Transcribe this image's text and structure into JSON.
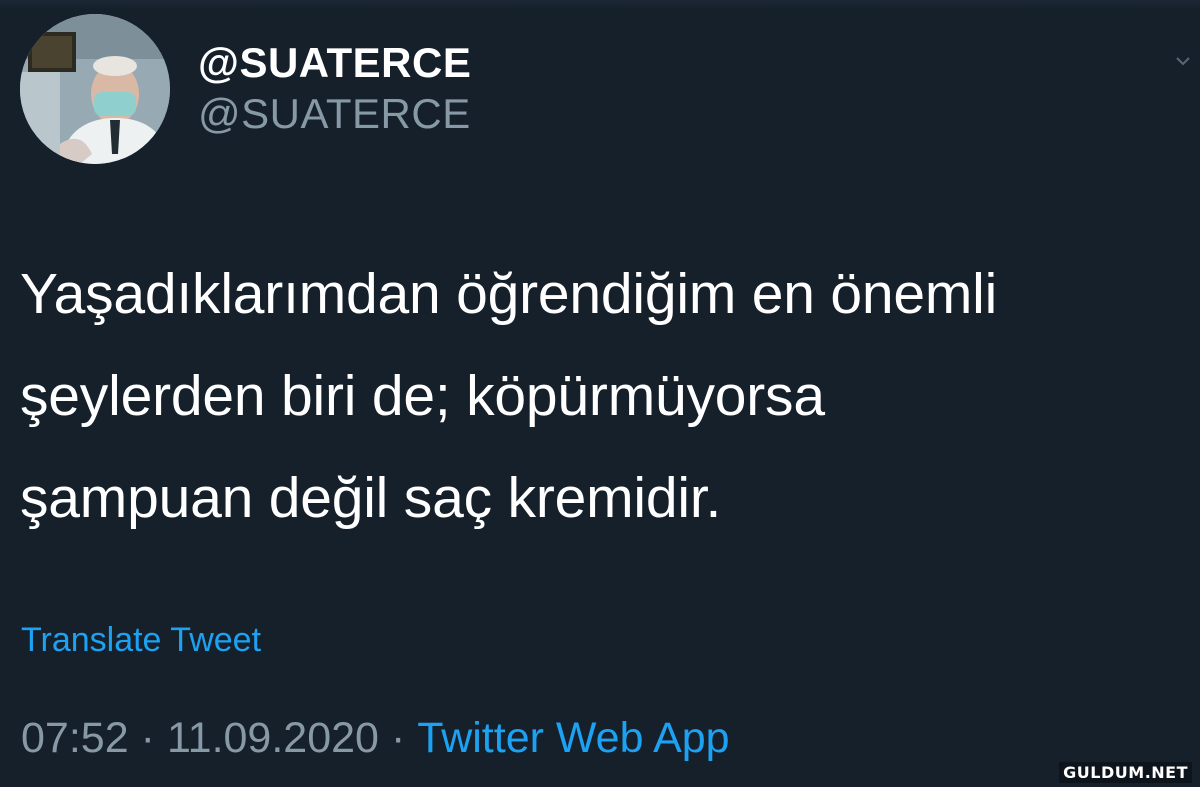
{
  "tweet": {
    "display_name": "@SUATERCE",
    "handle": "@SUATERCE",
    "text_lines": [
      "Yaşadıklarımdan öğrendiğim en önemli",
      "şeylerden biri de; köpürmüyorsa",
      "şampuan değil saç kremidir."
    ],
    "translate_label": "Translate Tweet",
    "time": "07:52",
    "date": "11.09.2020",
    "separator": "·",
    "source": "Twitter Web App"
  },
  "watermark": "GULDUM.NET",
  "colors": {
    "background": "#15202b",
    "text": "#ffffff",
    "muted": "#8899a6",
    "accent": "#1da1f2"
  },
  "icons": {
    "more": "chevron-down-icon"
  }
}
